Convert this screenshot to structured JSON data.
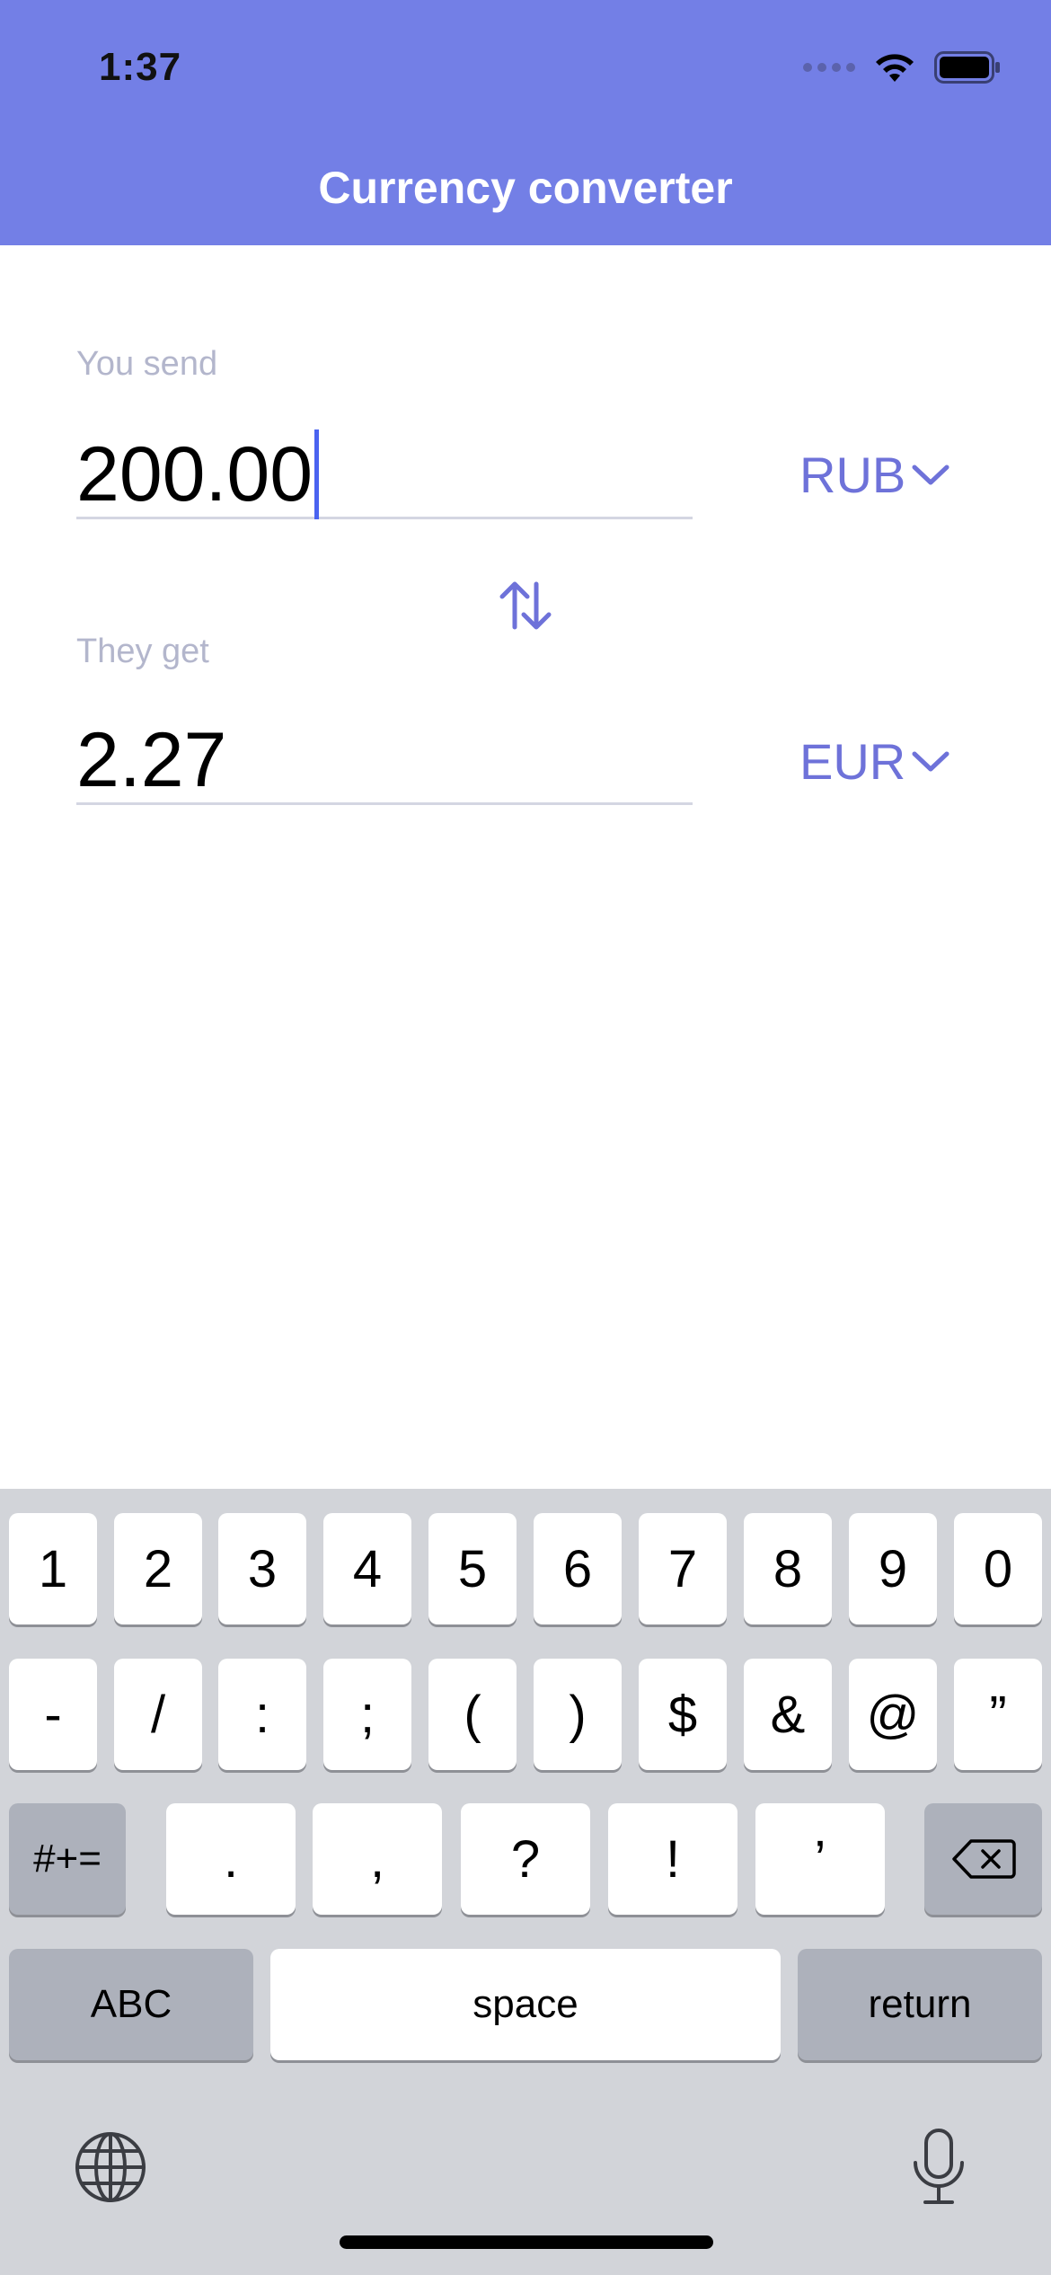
{
  "status_bar": {
    "time": "1:37"
  },
  "header": {
    "title": "Currency converter",
    "color": "#737fe6"
  },
  "form": {
    "send_label": "You send",
    "send_amount": "200.00",
    "send_currency": "RUB",
    "get_label": "They get",
    "get_amount": "2.27",
    "get_currency": "EUR"
  },
  "keyboard": {
    "row1": [
      "1",
      "2",
      "3",
      "4",
      "5",
      "6",
      "7",
      "8",
      "9",
      "0"
    ],
    "row2": [
      "-",
      "/",
      ":",
      ";",
      "(",
      ")",
      "$",
      "&",
      "@",
      "”"
    ],
    "row3_mode": "#+=",
    "row3": [
      ".",
      ",",
      "?",
      "!",
      "’"
    ],
    "abc": "ABC",
    "space": "space",
    "return": "return"
  },
  "icons": [
    "wifi-icon",
    "battery-icon",
    "swap-icon",
    "chevron-down-icon",
    "delete-icon",
    "globe-icon",
    "microphone-icon"
  ]
}
